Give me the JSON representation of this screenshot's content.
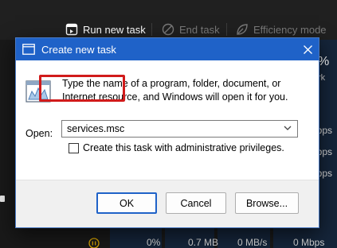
{
  "toolbar": {
    "run_new_task": "Run new task",
    "end_task": "End task",
    "efficiency_mode": "Efficiency mode"
  },
  "table": {
    "header_pct": "%",
    "header_sub": "rk",
    "cells": [
      "bps",
      "bps",
      "bps"
    ],
    "last_row": {
      "cpu": "0%",
      "memory": "0.7 MB",
      "disk": "0 MB/s",
      "network": "0 Mbps"
    }
  },
  "dialog": {
    "title": "Create new task",
    "description": "Type the name of a program, folder, document, or Internet resource, and Windows will open it for you.",
    "open_label": "Open:",
    "open_value": "services.msc",
    "admin_checkbox_label": "Create this task with administrative privileges.",
    "admin_checked": false,
    "buttons": {
      "ok": "OK",
      "cancel": "Cancel",
      "browse": "Browse..."
    }
  },
  "colors": {
    "titlebar": "#1f62c8",
    "highlight": "#d11b1b",
    "background": "#1c1c1c"
  },
  "icons": [
    "run-task-icon",
    "end-task-icon",
    "efficiency-leaf-icon",
    "window-app-icon",
    "close-icon",
    "run-dialog-icon",
    "chevron-down-icon",
    "status-paused-icon"
  ]
}
